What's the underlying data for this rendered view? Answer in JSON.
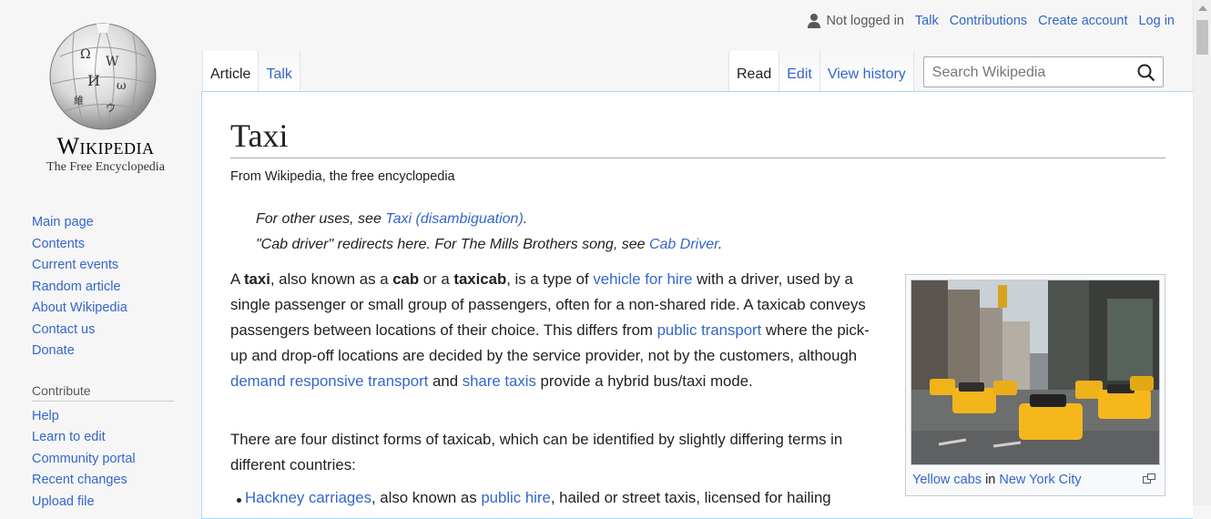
{
  "logo": {
    "wordmark": "Wikipedia",
    "tagline": "The Free Encyclopedia"
  },
  "personal": {
    "not_logged_in": "Not logged in",
    "talk": "Talk",
    "contributions": "Contributions",
    "create_account": "Create account",
    "login": "Log in"
  },
  "tabs_left": [
    "Article",
    "Talk"
  ],
  "tabs_right": [
    "Read",
    "Edit",
    "View history"
  ],
  "search": {
    "placeholder": "Search Wikipedia"
  },
  "sidebar": {
    "navigation": [
      "Main page",
      "Contents",
      "Current events",
      "Random article",
      "About Wikipedia",
      "Contact us",
      "Donate"
    ],
    "contribute_heading": "Contribute",
    "contribute": [
      "Help",
      "Learn to edit",
      "Community portal",
      "Recent changes",
      "Upload file"
    ]
  },
  "article": {
    "title": "Taxi",
    "from": "From Wikipedia, the free encyclopedia",
    "hatnote1": {
      "pre": "For other uses, see ",
      "link": "Taxi (disambiguation)",
      "post": "."
    },
    "hatnote2": {
      "pre": "\"Cab driver\" redirects here. For The Mills Brothers song, see ",
      "link": "Cab Driver",
      "post": "."
    },
    "p1": {
      "a": "A ",
      "taxi": "taxi",
      "b": ", also known as a ",
      "cab": "cab",
      "c": " or a ",
      "taxicab": "taxicab",
      "d": ", is a type of ",
      "l1": "vehicle for hire",
      "e": " with a driver, used by a single passenger or small group of passengers, often for a non-shared ride. A taxicab conveys passengers between locations of their choice. This differs from ",
      "l2": "public transport",
      "f": " where the pick-up and drop-off locations are decided by the service provider, not by the customers, although ",
      "l3": "demand responsive transport",
      "g": " and ",
      "l4": "share taxis",
      "h": " provide a hybrid bus/taxi mode."
    },
    "p2": "There are four distinct forms of taxicab, which can be identified by slightly differing terms in different countries:",
    "bullet": {
      "l1": "Hackney carriages",
      "a": ", also known as ",
      "l2": "public hire",
      "b": ", hailed or street taxis, licensed for hailing"
    },
    "caption": {
      "l1": "Yellow cabs",
      "a": " in ",
      "l2": "New York City"
    }
  }
}
